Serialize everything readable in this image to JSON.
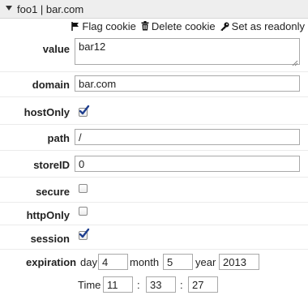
{
  "header": {
    "title": "foo1 | bar.com"
  },
  "toolbar": {
    "flag_label": "Flag cookie",
    "delete_label": "Delete cookie",
    "readonly_label": "Set as readonly"
  },
  "fields": {
    "value": {
      "label": "value",
      "text": "bar12"
    },
    "domain": {
      "label": "domain",
      "text": "bar.com"
    },
    "hostOnly": {
      "label": "hostOnly",
      "checked": true
    },
    "path": {
      "label": "path",
      "text": "/"
    },
    "storeID": {
      "label": "storeID",
      "text": "0"
    },
    "secure": {
      "label": "secure",
      "checked": false
    },
    "httpOnly": {
      "label": "httpOnly",
      "checked": false
    },
    "session": {
      "label": "session",
      "checked": true
    }
  },
  "expiration": {
    "label": "expiration",
    "day_label": "day",
    "day": "4",
    "month_label": "month",
    "month": "5",
    "year_label": "year",
    "year": "2013",
    "time_label": "Time",
    "hour": "11",
    "minute": "33",
    "second": "27",
    "colon": ":"
  },
  "colors": {
    "checkmark": "#1f3f8f",
    "border": "#a9a9a9"
  }
}
